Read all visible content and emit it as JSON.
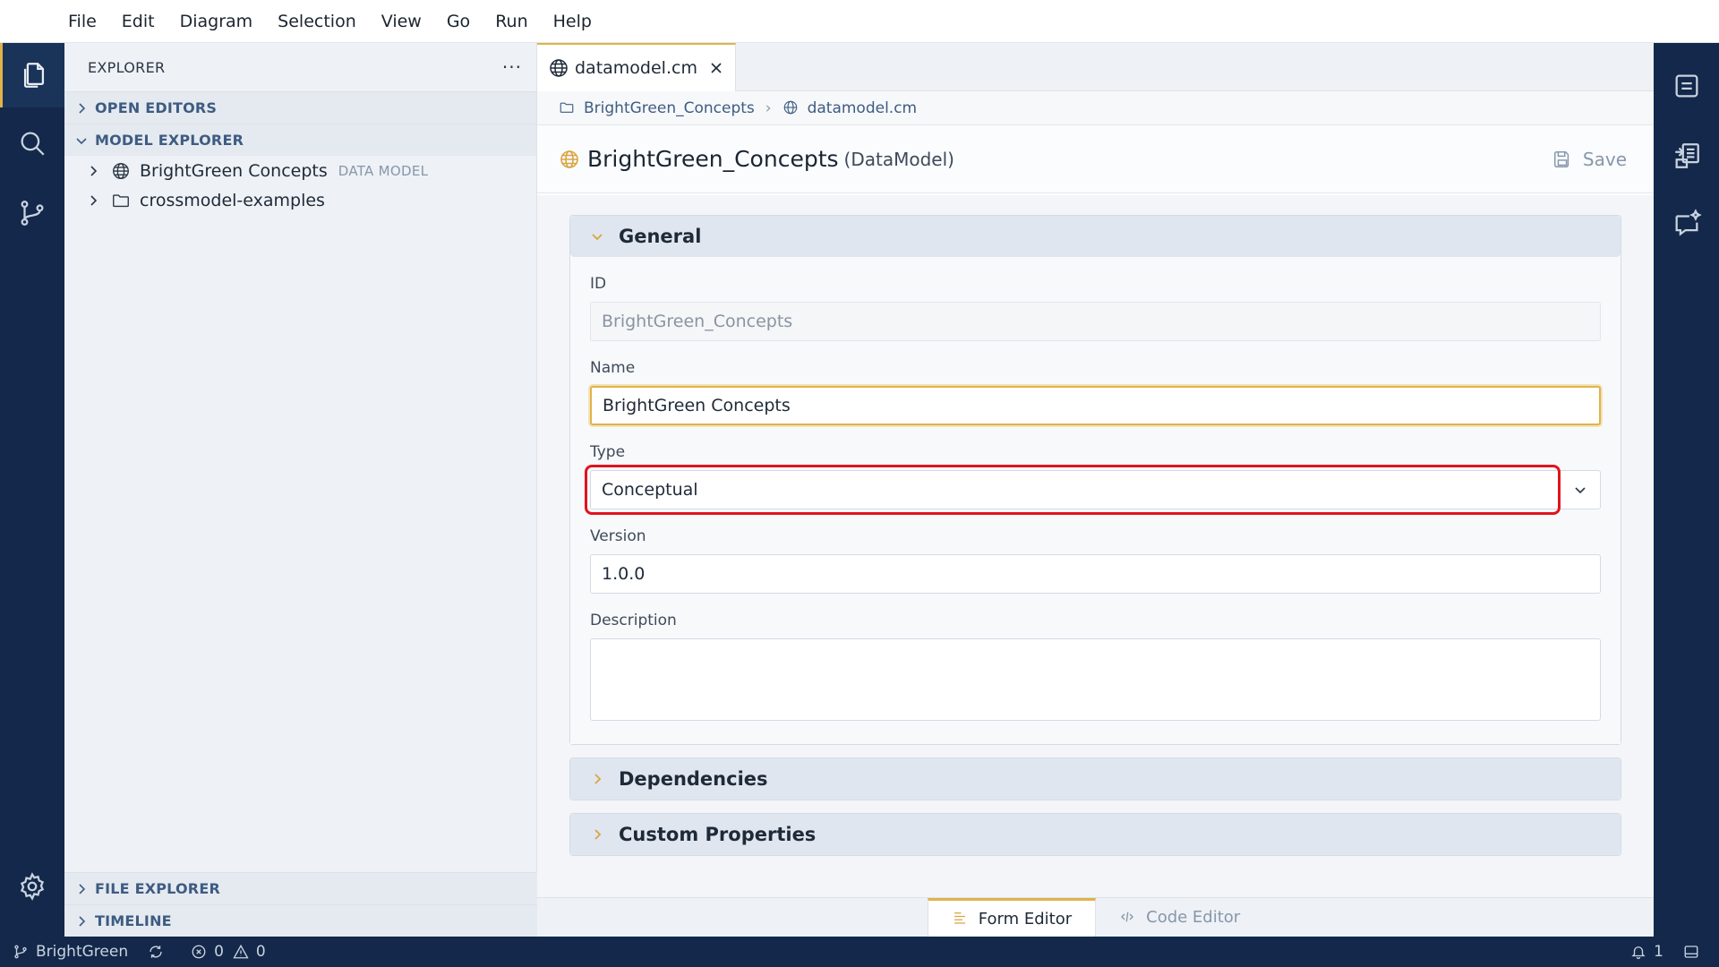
{
  "menu": [
    "File",
    "Edit",
    "Diagram",
    "Selection",
    "View",
    "Go",
    "Run",
    "Help"
  ],
  "colors": {
    "accent": "#e0b34a",
    "activity_bar": "#13284a",
    "highlight": "#e0141e",
    "muted": "#8797ab"
  },
  "sidebar": {
    "title": "EXPLORER",
    "more": "···",
    "sections": {
      "open_editors": "OPEN EDITORS",
      "model_explorer": "MODEL EXPLORER",
      "file_explorer": "FILE EXPLORER",
      "timeline": "TIMELINE"
    },
    "tree": [
      {
        "label": "BrightGreen Concepts",
        "badge": "DATA MODEL",
        "icon": "globe-icon"
      },
      {
        "label": "crossmodel-examples",
        "badge": "",
        "icon": "folder-icon"
      }
    ]
  },
  "editor": {
    "tab": {
      "label": "datamodel.cm",
      "icon": "globe-icon"
    },
    "breadcrumb": [
      {
        "label": "BrightGreen_Concepts",
        "icon": "folder-icon"
      },
      {
        "label": "datamodel.cm",
        "icon": "globe-icon"
      }
    ],
    "breadcrumb_sep": "›",
    "title": "BrightGreen_Concepts",
    "kind": "(DataModel)",
    "save_label": "Save"
  },
  "form": {
    "general_label": "General",
    "id": {
      "label": "ID",
      "value": "BrightGreen_Concepts"
    },
    "name": {
      "label": "Name",
      "value": "BrightGreen Concepts"
    },
    "type": {
      "label": "Type",
      "value": "Conceptual"
    },
    "version": {
      "label": "Version",
      "value": "1.0.0"
    },
    "description": {
      "label": "Description",
      "value": ""
    },
    "dependencies_label": "Dependencies",
    "custom_properties_label": "Custom Properties"
  },
  "bottom_tabs": {
    "form_editor": "Form Editor",
    "code_editor": "Code Editor"
  },
  "status": {
    "branch": "BrightGreen",
    "errors": "0",
    "warnings": "0",
    "notifications": "1"
  }
}
